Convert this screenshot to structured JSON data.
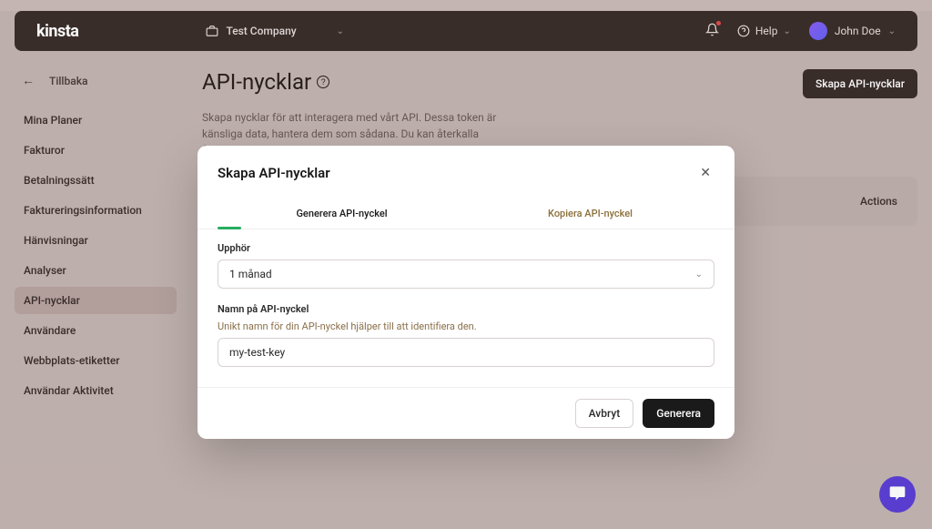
{
  "topbar": {
    "logo": "kinsta",
    "company": "Test Company",
    "help": "Help",
    "user": "John Doe"
  },
  "sidebar": {
    "back": "Tillbaka",
    "items": [
      "Mina Planer",
      "Fakturor",
      "Betalningssätt",
      "Faktureringsinformation",
      "Hänvisningar",
      "Analyser",
      "API-nycklar",
      "Användare",
      "Webbplats-etiketter",
      "Användar Aktivitet"
    ],
    "activeIndex": 6
  },
  "page": {
    "title": "API-nycklar",
    "description": "Skapa nycklar för att interagera med vårt API. Dessa token är känsliga data, hantera dem som sådana. Du kan återkalla åtkomsten när du vill.",
    "createBtn": "Skapa API-nycklar"
  },
  "card": {
    "actionsCol": "Actions"
  },
  "modal": {
    "title": "Skapa API-nycklar",
    "tabs": {
      "generate": "Generera API-nyckel",
      "copy": "Kopiera API-nyckel"
    },
    "expires": {
      "label": "Upphör",
      "value": "1 månad"
    },
    "name": {
      "label": "Namn på API-nyckel",
      "helper": "Unikt namn för din API-nyckel hjälper till att identifiera den.",
      "value": "my-test-key"
    },
    "footer": {
      "cancel": "Avbryt",
      "generate": "Generera"
    }
  }
}
